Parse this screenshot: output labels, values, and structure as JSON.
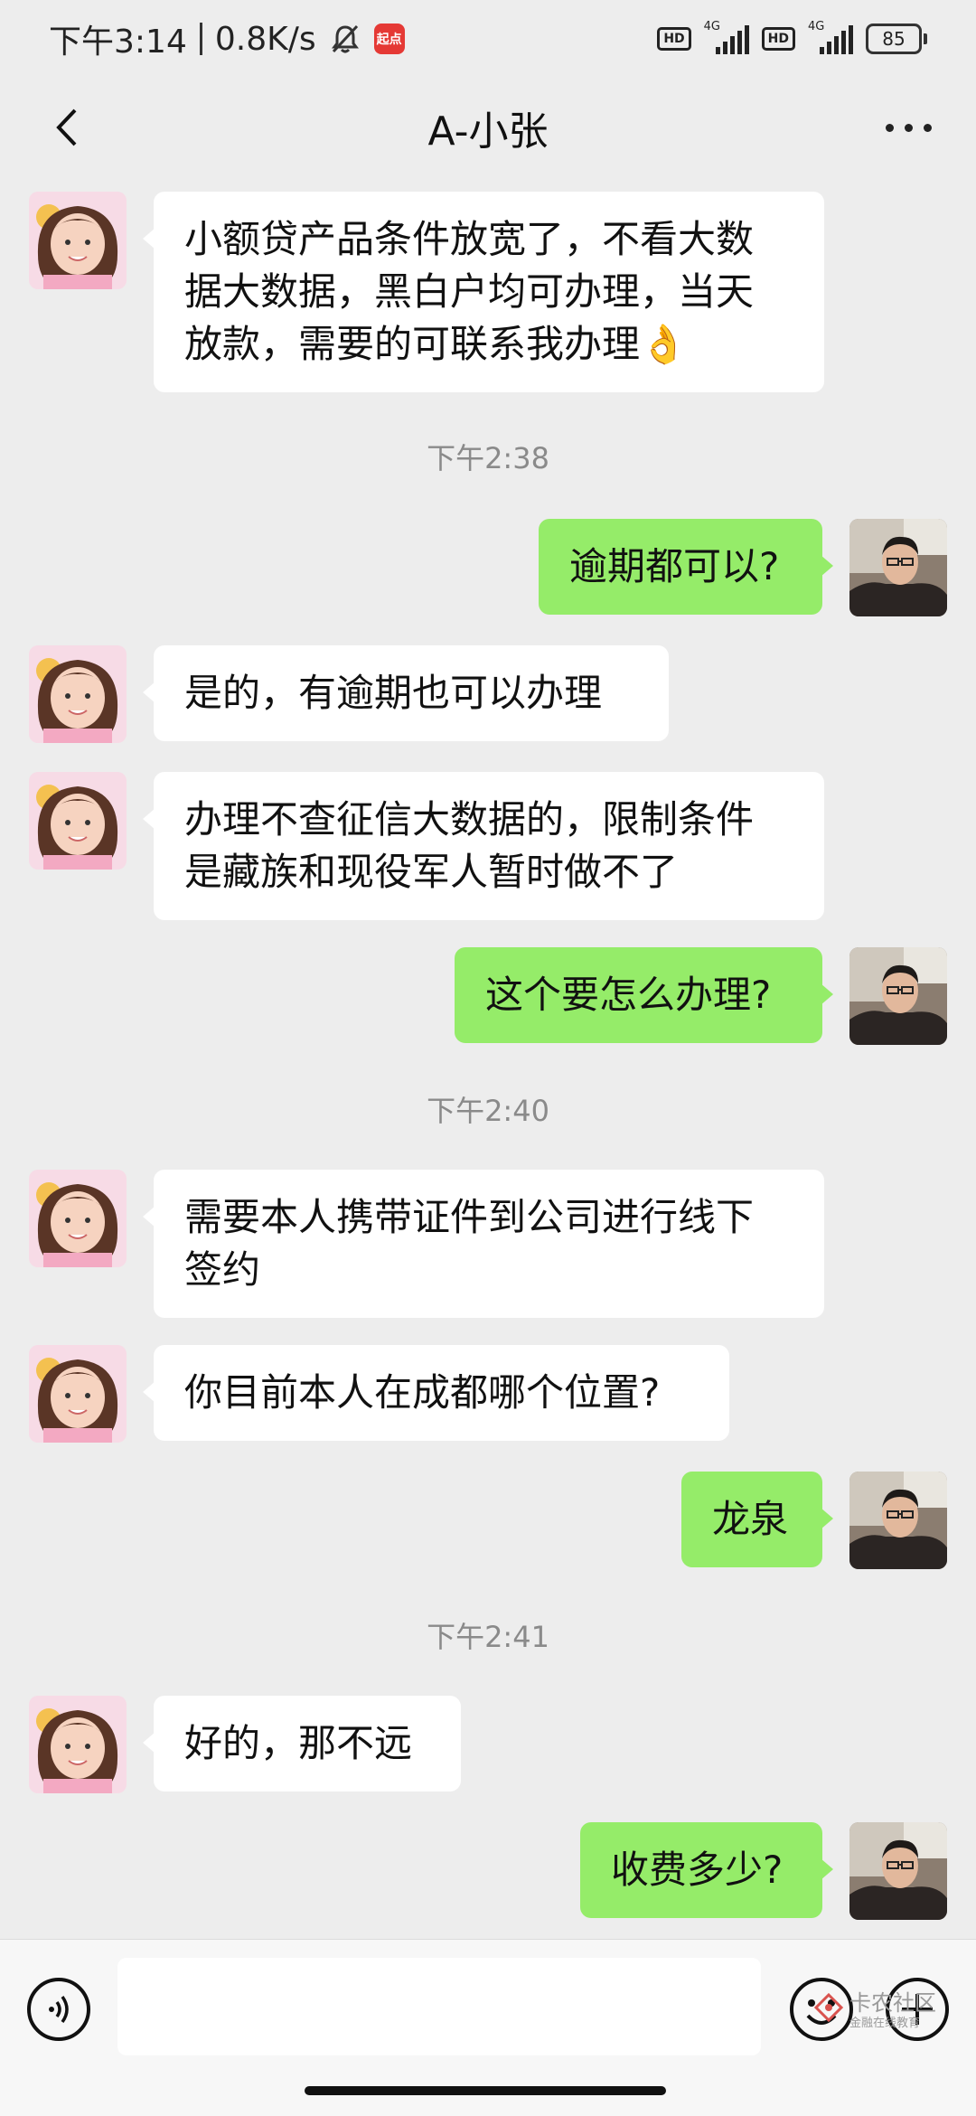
{
  "status_bar": {
    "time": "下午3:14",
    "network_speed": "0.8K/s",
    "app_badge": "起点",
    "sim1": {
      "hd": "HD",
      "gen": "4G"
    },
    "sim2": {
      "hd": "HD",
      "gen": "4G"
    },
    "battery": "85"
  },
  "header": {
    "title": "A-小张"
  },
  "messages": [
    {
      "direction": "in",
      "text_lines": [
        "小额贷产品条件放宽了，不看大数",
        "据大数据，黑白户均可办理，当天",
        "放款，需要的可联系我办理👌"
      ]
    },
    {
      "type": "time",
      "text": "下午2:38"
    },
    {
      "direction": "out",
      "text": "逾期都可以?"
    },
    {
      "direction": "in",
      "text": "是的，有逾期也可以办理"
    },
    {
      "direction": "in",
      "text_lines": [
        "办理不查征信大数据的，限制条件",
        "是藏族和现役军人暂时做不了"
      ]
    },
    {
      "direction": "out",
      "text": "这个要怎么办理?"
    },
    {
      "type": "time",
      "text": "下午2:40"
    },
    {
      "direction": "in",
      "text_lines": [
        "需要本人携带证件到公司进行线下",
        "签约"
      ]
    },
    {
      "direction": "in",
      "text": "你目前本人在成都哪个位置?"
    },
    {
      "direction": "out",
      "text": "龙泉"
    },
    {
      "type": "time",
      "text": "下午2:41"
    },
    {
      "direction": "in",
      "text": "好的，那不远"
    },
    {
      "direction": "out",
      "text": "收费多少?"
    }
  ],
  "input_bar": {
    "voice_icon": "voice-icon",
    "emoji_icon": "emoji-icon",
    "add_icon": "plus-circle-icon"
  },
  "watermark": {
    "main": "卡农社区",
    "sub": "金融在线教育"
  },
  "colors": {
    "background": "#ededed",
    "incoming_bubble": "#ffffff",
    "outgoing_bubble": "#95ec69",
    "timestamp_text": "#8a8a8a"
  }
}
